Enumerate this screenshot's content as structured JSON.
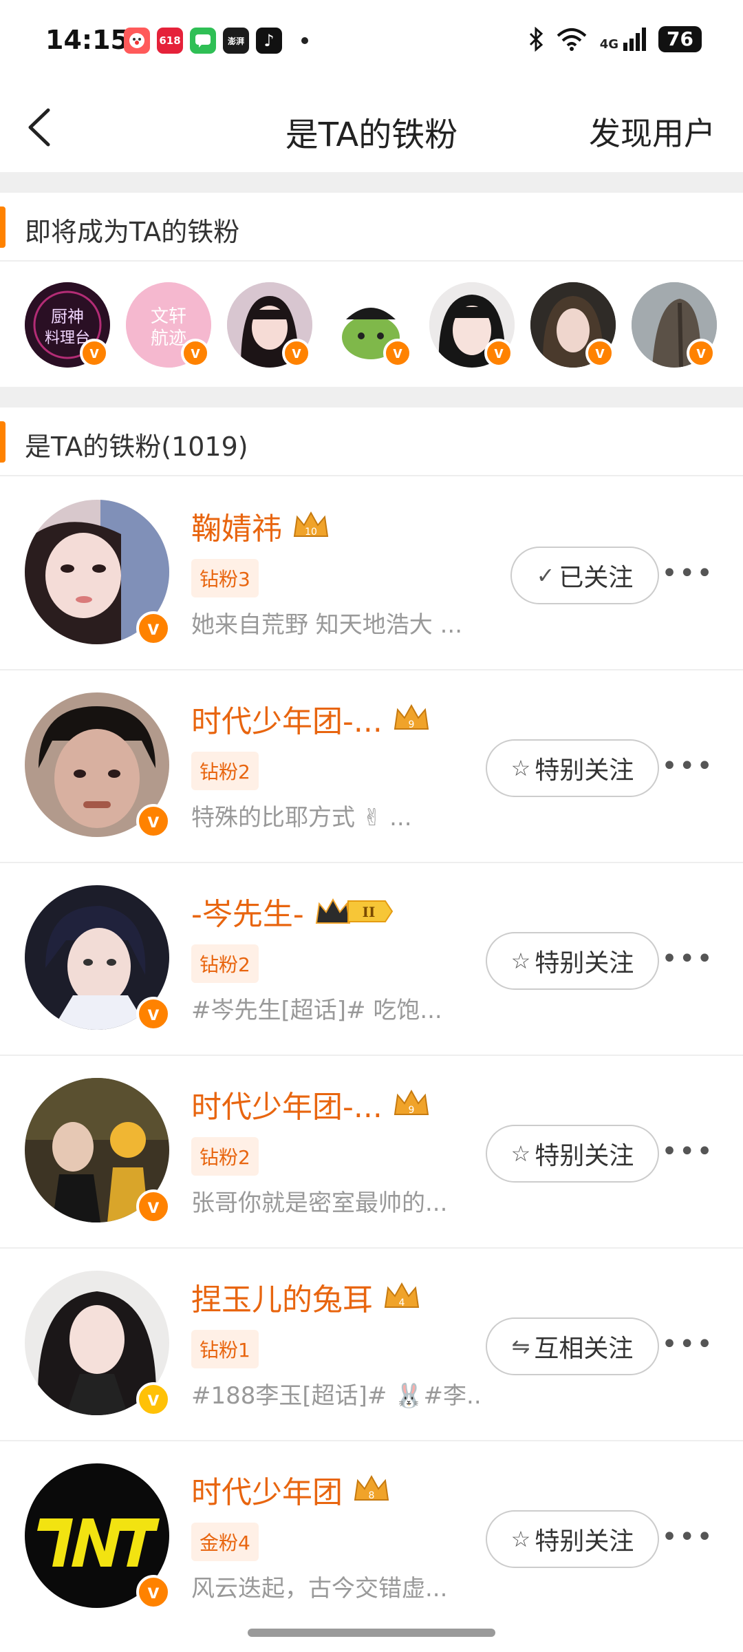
{
  "status_bar": {
    "time": "14:15",
    "apps": [
      {
        "icon": "clown-app-icon",
        "color": "#ff5a5a",
        "label": ""
      },
      {
        "icon": "shopping-618-app-icon",
        "color": "#e5223a",
        "label": "618"
      },
      {
        "icon": "chat-app-icon",
        "color": "#2fbf55",
        "label": ""
      },
      {
        "icon": "news-app-icon",
        "color": "#1b1b1b",
        "label": "澎湃"
      },
      {
        "icon": "tiktok-app-icon",
        "color": "#111111",
        "label": "♪"
      }
    ],
    "network": "4G",
    "battery": "76"
  },
  "nav": {
    "title": "是TA的铁粉",
    "right_action": "发现用户"
  },
  "upcoming": {
    "title": "即将成为TA的铁粉",
    "avatars": [
      {
        "name": "avatar-chef",
        "text": "厨神\n料理台",
        "bg": "#3a1530",
        "badge": "orange"
      },
      {
        "name": "avatar-wenxuan",
        "text": "文轩\n航迹",
        "bg": "#f2b6cc",
        "badge": "orange"
      },
      {
        "name": "avatar-girl-1",
        "text": "",
        "bg": "#d9c9d2",
        "badge": "orange"
      },
      {
        "name": "avatar-cartoon",
        "text": "",
        "bg": "#ffffff",
        "badge": "orange"
      },
      {
        "name": "avatar-girl-2",
        "text": "",
        "bg": "#e9e6e6",
        "badge": "orange"
      },
      {
        "name": "avatar-girl-3",
        "text": "",
        "bg": "#2e2b28",
        "badge": "orange"
      },
      {
        "name": "avatar-girl-4",
        "text": "",
        "bg": "#9aa3a8",
        "badge": "orange"
      }
    ]
  },
  "fans_section": {
    "title": "是TA的铁粉(1019)"
  },
  "fans": [
    {
      "name": "鞠婧祎",
      "tag": "钻粉3",
      "desc": "她来自荒野 知天地浩大 ...",
      "button": "已关注",
      "button_icon": "✓",
      "icon_name": "check-icon",
      "avatar_bg": "#d8c6c8",
      "badge": "orange",
      "crown_level": "10"
    },
    {
      "name": "时代少年团-...",
      "tag": "钻粉2",
      "desc": "特殊的比耶方式 ✌ ...",
      "button": "特别关注",
      "button_icon": "☆",
      "icon_name": "star-icon",
      "avatar_bg": "#b89b8c",
      "badge": "orange",
      "crown_level": "9"
    },
    {
      "name": "-岑先生-",
      "tag": "钻粉2",
      "desc": "#岑先生[超话]# 吃饱...",
      "button": "特别关注",
      "button_icon": "☆",
      "icon_name": "star-icon",
      "avatar_bg": "#2a2c3e",
      "badge": "orange",
      "crown_level": "II"
    },
    {
      "name": "时代少年团-...",
      "tag": "钻粉2",
      "desc": "张哥你就是密室最帅的...",
      "button": "特别关注",
      "button_icon": "☆",
      "icon_name": "star-icon",
      "avatar_bg": "#4a3e2c",
      "badge": "orange",
      "crown_level": "9"
    },
    {
      "name": "捏玉儿的兔耳",
      "tag": "钻粉1",
      "desc": "#188李玉[超话]# 🐰#李...",
      "button": "互相关注",
      "button_icon": "⇋",
      "icon_name": "mutual-icon",
      "avatar_bg": "#e8e6e4",
      "badge": "gold",
      "crown_level": "4"
    },
    {
      "name": "时代少年团",
      "tag": "金粉4",
      "desc": "风云迭起，古今交错虚...",
      "button": "特别关注",
      "button_icon": "☆",
      "icon_name": "star-icon",
      "avatar_bg": "#0a0a0a",
      "badge": "orange",
      "crown_level": "8"
    }
  ],
  "colors": {
    "accent": "#ff8200",
    "name": "#e8650f",
    "tag_bg": "#fff0e6",
    "gray_text": "#999999",
    "gap": "#efefef"
  }
}
